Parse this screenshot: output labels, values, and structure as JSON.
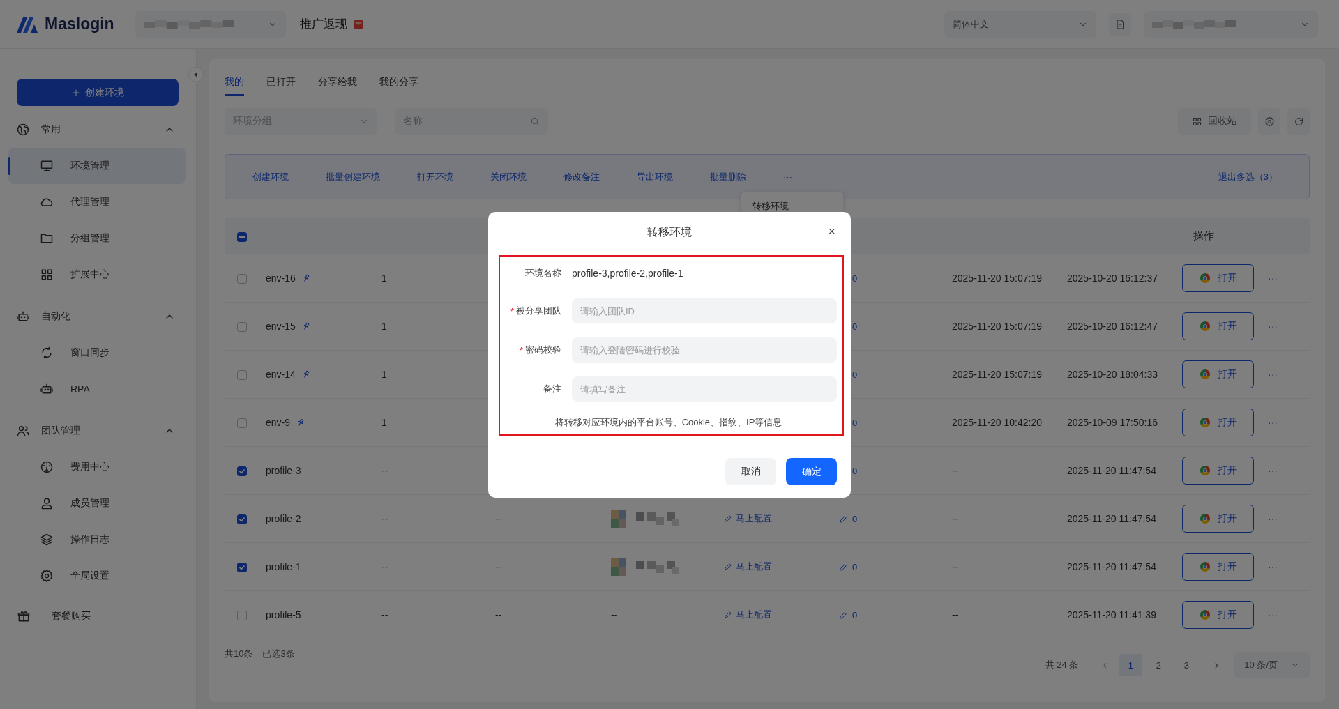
{
  "topbar": {
    "logo": "Maslogin",
    "promo": "推广返现",
    "language": "简体中文"
  },
  "sidebar": {
    "create_button": "创建环境",
    "groups": [
      {
        "label": "常用",
        "expanded": true,
        "items": [
          {
            "label": "环境管理",
            "selected": true
          },
          {
            "label": "代理管理",
            "selected": false
          },
          {
            "label": "分组管理",
            "selected": false
          },
          {
            "label": "扩展中心",
            "selected": false
          }
        ]
      },
      {
        "label": "自动化",
        "expanded": true,
        "items": [
          {
            "label": "窗口同步",
            "selected": false
          },
          {
            "label": "RPA",
            "selected": false
          }
        ]
      },
      {
        "label": "团队管理",
        "expanded": true,
        "items": [
          {
            "label": "费用中心",
            "selected": false
          },
          {
            "label": "成员管理",
            "selected": false
          },
          {
            "label": "操作日志",
            "selected": false
          },
          {
            "label": "全局设置",
            "selected": false
          }
        ]
      }
    ],
    "footer_item": "套餐购买"
  },
  "tabs": [
    {
      "label": "我的",
      "selected": true
    },
    {
      "label": "已打开",
      "selected": false
    },
    {
      "label": "分享给我",
      "selected": false
    },
    {
      "label": "我的分享",
      "selected": false
    }
  ],
  "filters": {
    "group_select": {
      "placeholder": "环境分组"
    },
    "search": {
      "placeholder": "名称"
    },
    "recycle_button": "回收站"
  },
  "bulk_bar": {
    "actions": [
      "创建环境",
      "批量创建环境",
      "打开环境",
      "关闭环境",
      "修改备注",
      "导出环境",
      "批量删除"
    ],
    "more": "···",
    "exit": "退出多选（3）"
  },
  "more_menu": {
    "items": [
      "转移环境"
    ]
  },
  "table": {
    "select_all_partial": true,
    "action_column": "操作",
    "rows": [
      {
        "name": "env-16",
        "pinned": true,
        "checked": false,
        "column_2": "1",
        "column_6": "0",
        "column_7": "2025-11-20 15:07:19",
        "column_8": "2025-10-20 16:12:37",
        "action": "打开",
        "more": "···"
      },
      {
        "name": "env-15",
        "pinned": true,
        "checked": false,
        "column_2": "1",
        "column_6": "0",
        "column_7": "2025-11-20 15:07:19",
        "column_8": "2025-10-20 16:12:47",
        "action": "打开",
        "more": "···"
      },
      {
        "name": "env-14",
        "pinned": true,
        "checked": false,
        "column_2": "1",
        "column_6": "0",
        "column_7": "2025-11-20 15:07:19",
        "column_8": "2025-10-20 18:04:33",
        "action": "打开",
        "more": "···"
      },
      {
        "name": "env-9",
        "pinned": true,
        "checked": false,
        "column_2": "1",
        "column_6": "0",
        "column_7": "2025-11-20 10:42:20",
        "column_8": "2025-10-09 17:50:16",
        "action": "打开",
        "more": "···"
      },
      {
        "name": "profile-3",
        "pinned": false,
        "checked": true,
        "column_2": "--",
        "column_6": "0",
        "column_7": "--",
        "column_8": "2025-11-20 11:47:54",
        "action": "打开",
        "more": "···"
      },
      {
        "name": "profile-2",
        "pinned": false,
        "checked": true,
        "column_2": "--",
        "column_3": "--",
        "column_5": "马上配置",
        "column_6": "0",
        "column_7": "--",
        "column_8": "2025-11-20 11:47:54",
        "action": "打开",
        "more": "···"
      },
      {
        "name": "profile-1",
        "pinned": false,
        "checked": true,
        "column_2": "--",
        "column_3": "--",
        "column_5": "马上配置",
        "column_6": "0",
        "column_7": "--",
        "column_8": "2025-11-20 11:47:54",
        "action": "打开",
        "more": "···"
      },
      {
        "name": "profile-5",
        "pinned": false,
        "checked": false,
        "column_2": "--",
        "column_3": "--",
        "column_4": {
          "kind": "text",
          "text": "--"
        },
        "column_5": "马上配置",
        "column_6": "0",
        "column_7": "--",
        "column_8": "2025-11-20 11:41:39",
        "action": "打开",
        "more": "···"
      }
    ]
  },
  "footer": {
    "total": "共10条",
    "selected": "已选3条"
  },
  "pagination": {
    "total": "共 24 条",
    "prev": "‹",
    "pages": [
      {
        "label": "1",
        "selected": true
      },
      {
        "label": "2",
        "selected": false
      },
      {
        "label": "3",
        "selected": false
      }
    ],
    "next": "›",
    "page_size": "10 条/页"
  },
  "dialog": {
    "title": "转移环境",
    "close": "×",
    "highlighted": true,
    "required_mark": "*",
    "fields": [
      {
        "kind": "text",
        "label": "环境名称",
        "required": false,
        "value": "profile-3,profile-2,profile-1"
      },
      {
        "kind": "input",
        "label": "被分享团队",
        "required": true,
        "placeholder": "请输入团队ID"
      },
      {
        "kind": "input",
        "label": "密码校验",
        "required": true,
        "placeholder": "请输入登陆密码进行校验"
      },
      {
        "kind": "input",
        "label": "备注",
        "required": false,
        "placeholder": "请填写备注"
      }
    ],
    "note": "将转移对应环境内的平台账号、Cookie、指纹、IP等信息",
    "buttons": [
      {
        "label": "取消",
        "kind": "secondary"
      },
      {
        "label": "确定",
        "kind": "primary"
      }
    ]
  }
}
